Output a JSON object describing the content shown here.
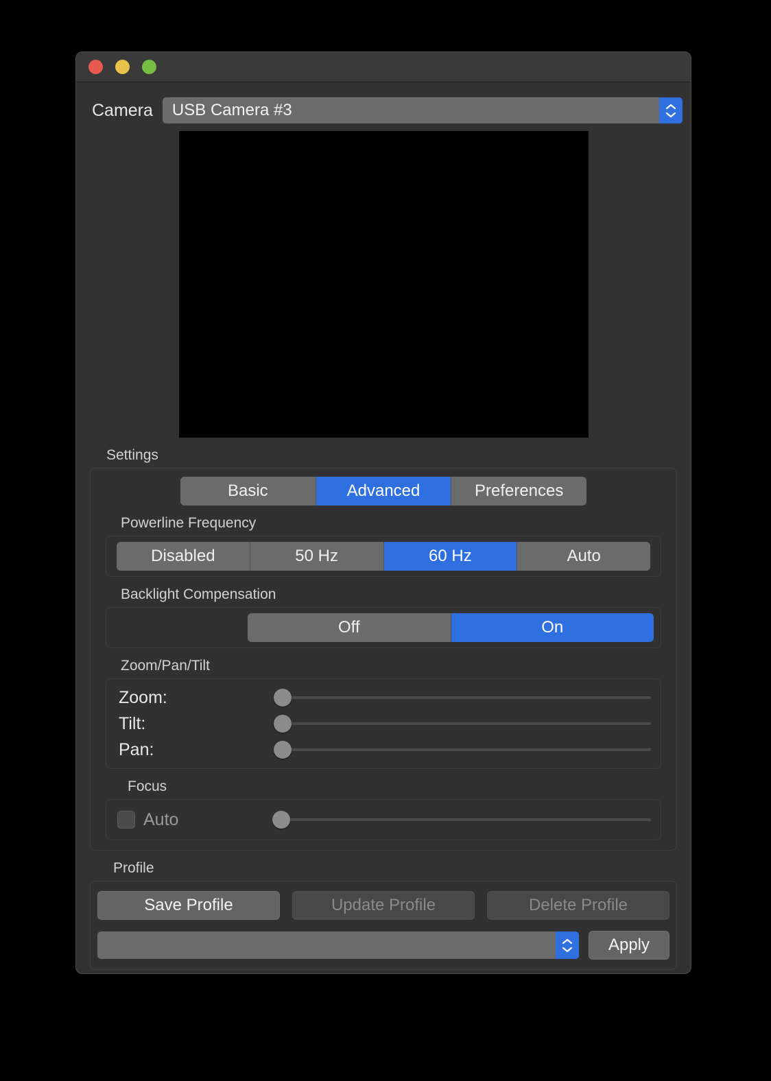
{
  "window": {
    "traffic_lights": {
      "close": "close-button",
      "minimize": "minimize-button",
      "maximize": "maximize-button"
    },
    "colors": {
      "close": "#e8594f",
      "minimize": "#e8c24a",
      "maximize": "#74be44",
      "accent": "#2f6fe0",
      "window_bg": "#323232",
      "titlebar_bg": "#3a3a3a",
      "control_bg": "#6b6b6b",
      "preview_bg": "#000000"
    }
  },
  "camera": {
    "label": "Camera",
    "selected": "USB Camera #3"
  },
  "settings": {
    "label": "Settings",
    "tabs": [
      {
        "label": "Basic",
        "active": false
      },
      {
        "label": "Advanced",
        "active": true
      },
      {
        "label": "Preferences",
        "active": false
      }
    ],
    "powerline": {
      "label": "Powerline Frequency",
      "options": [
        {
          "label": "Disabled",
          "active": false
        },
        {
          "label": "50 Hz",
          "active": false
        },
        {
          "label": "60 Hz",
          "active": true
        },
        {
          "label": "Auto",
          "active": false
        }
      ]
    },
    "backlight": {
      "label": "Backlight Compensation",
      "options": [
        {
          "label": "Off",
          "active": false
        },
        {
          "label": "On",
          "active": true
        }
      ]
    },
    "zoom_pan_tilt": {
      "label": "Zoom/Pan/Tilt",
      "sliders": [
        {
          "label": "Zoom:",
          "value": 0
        },
        {
          "label": "Tilt:",
          "value": 0
        },
        {
          "label": "Pan:",
          "value": 0
        }
      ]
    },
    "focus": {
      "label": "Focus",
      "auto_label": "Auto",
      "auto_checked": false,
      "slider_value": 0
    }
  },
  "profile": {
    "label": "Profile",
    "buttons": [
      {
        "label": "Save Profile",
        "disabled": false
      },
      {
        "label": "Update Profile",
        "disabled": true
      },
      {
        "label": "Delete Profile",
        "disabled": true
      }
    ],
    "selected": "",
    "apply_label": "Apply"
  }
}
